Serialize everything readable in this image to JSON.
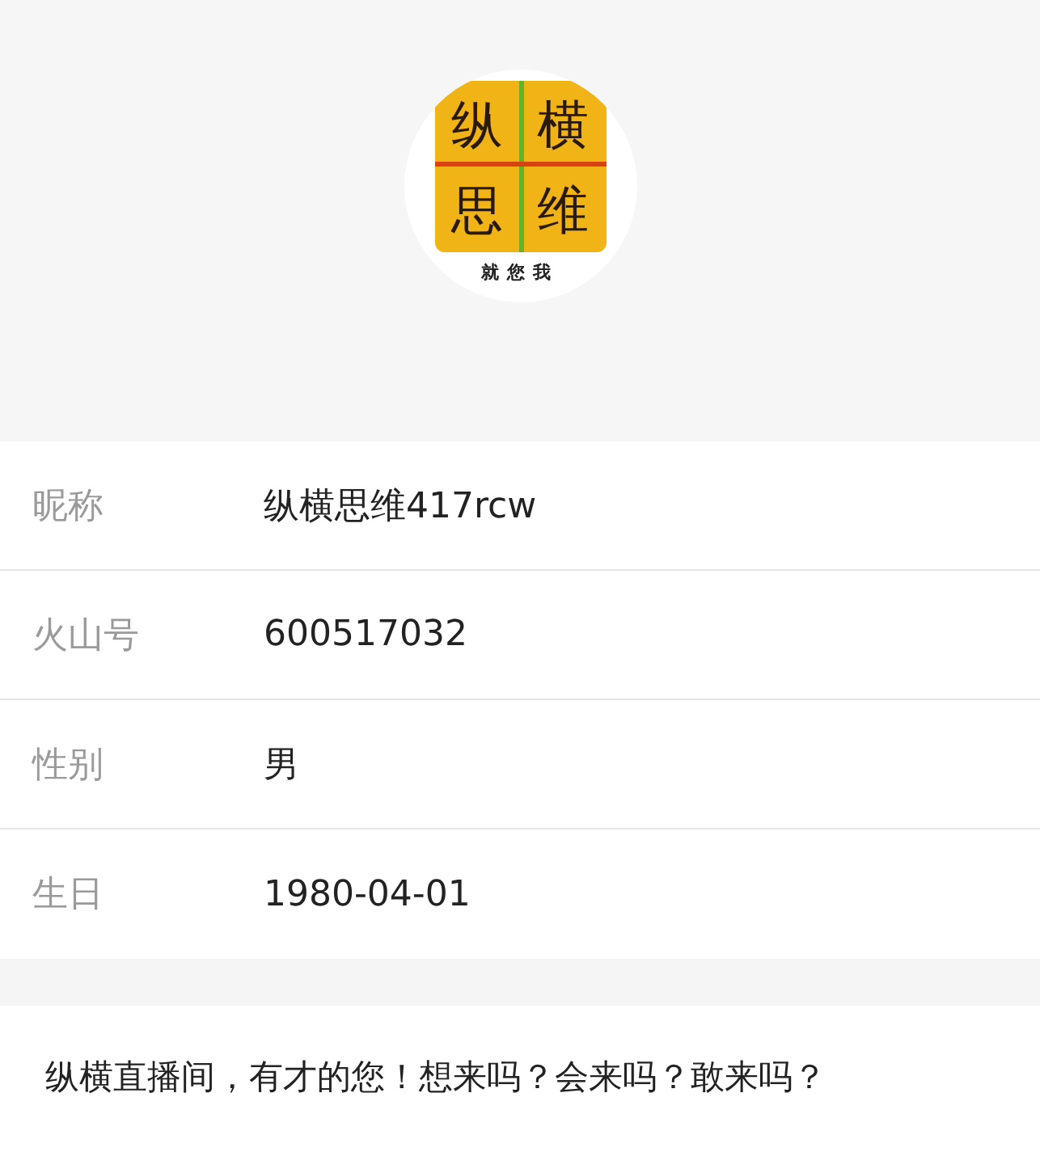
{
  "avatar": {
    "logo_characters": [
      "纵",
      "横",
      "思",
      "维"
    ],
    "caption": "就您我"
  },
  "fields": [
    {
      "label": "昵称",
      "value": "纵横思维417rcw"
    },
    {
      "label": "火山号",
      "value": "600517032"
    },
    {
      "label": "性别",
      "value": "男"
    },
    {
      "label": "生日",
      "value": "1980-04-01"
    }
  ],
  "bio": "纵横直播间，有才的您！想来吗？会来吗？敢来吗？"
}
